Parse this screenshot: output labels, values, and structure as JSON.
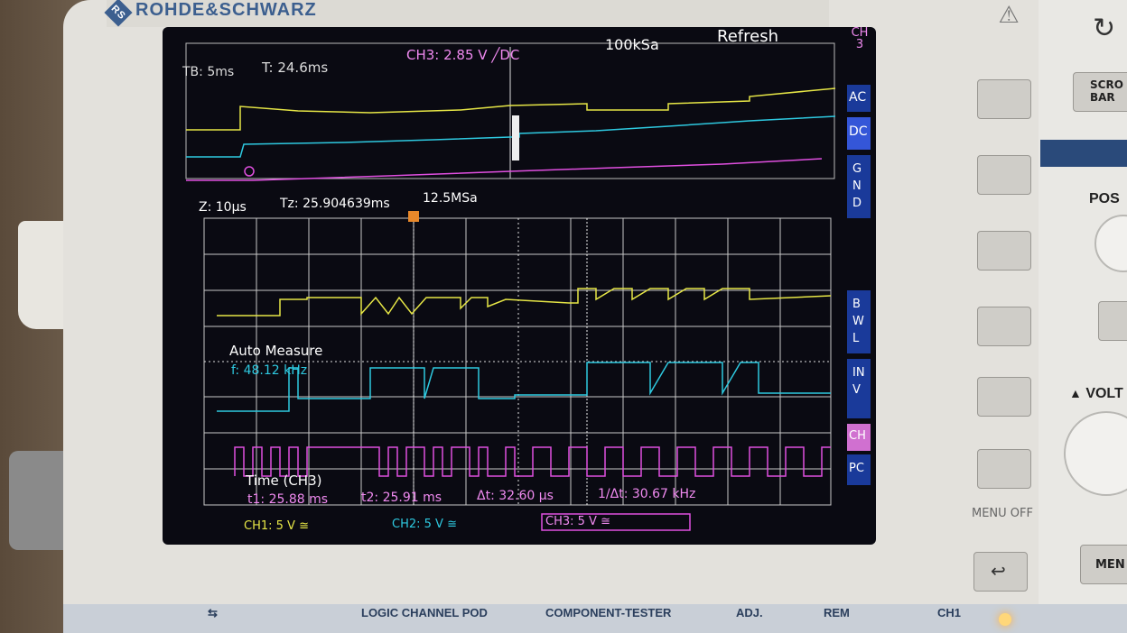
{
  "brand": "ROHDE&SCHWARZ",
  "topbar": {
    "timebase": "TB: 5ms",
    "trigger_time": "T: 24.6ms",
    "channel_setting": "CH3: 2.85 V ╱DC",
    "sample_rate": "100kSa",
    "refresh": "Refresh"
  },
  "zoom_bar": {
    "zoom": "Z: 10µs",
    "zoom_time": "Tz: 25.904639ms",
    "zoom_rate": "12.5MSa"
  },
  "softkeys": {
    "channel": "CH3",
    "ac": "AC",
    "dc": "DC",
    "gnd": "GND",
    "bwl": "BWL",
    "inv": "INV",
    "ch": "CH",
    "po": "PC"
  },
  "measure": {
    "title": "Auto Measure",
    "freq": "f: 48.12 kHz"
  },
  "cursor": {
    "title": "Time (CH3)",
    "t1": "t1: 25.88 ms",
    "t2": "t2: 25.91 ms",
    "dt": "Δt: 32.60 µs",
    "inv_dt": "1/Δt: 30.67 kHz"
  },
  "channels": [
    {
      "label": "CH1: 5 V ≅",
      "color": "#e6e646"
    },
    {
      "label": "CH2: 5 V ≅",
      "color": "#2ec9e0"
    },
    {
      "label": "CH3: 5 V ≅",
      "color": "#e04fe0"
    }
  ],
  "panel": {
    "menu_off": "MENU OFF",
    "volt": "VOLT",
    "pos": "POS",
    "scroll": "SCRO BAR",
    "menu": "MEN"
  },
  "bottom": {
    "logic": "LOGIC CHANNEL POD",
    "component": "COMPONENT-TESTER",
    "adj": "ADJ.",
    "rem": "REM",
    "ch1": "CH1"
  },
  "colors": {
    "ch1": "#e6e646",
    "ch2": "#2ec9e0",
    "ch3": "#e04fe0",
    "grid": "#c8c8c8",
    "softkey_blue": "#1a3a9a"
  }
}
